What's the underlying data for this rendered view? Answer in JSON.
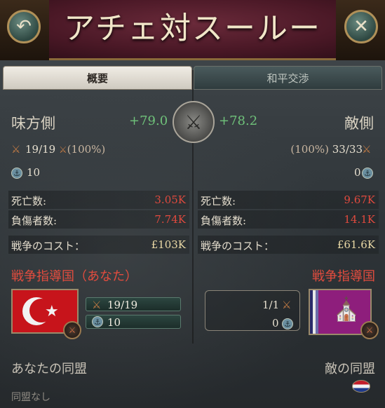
{
  "header": {
    "title": "アチェ対スールー",
    "back_icon": "back-arrow-icon",
    "close_icon": "close-icon"
  },
  "tabs": [
    {
      "label": "概要",
      "active": true
    },
    {
      "label": "和平交渉",
      "active": false
    }
  ],
  "center_icon": "crossed-swords-icon",
  "ally": {
    "title": "味方側",
    "score": "+79.0",
    "armies": "19/19",
    "armies_pct": "(​100%)",
    "ships": "10",
    "deaths_label": "死亡数:",
    "deaths": "3.05K",
    "wounded_label": "負傷者数:",
    "wounded": "7.74K",
    "cost_label": "戦争のコスト：",
    "cost": "£103K",
    "leader_label": "戦争指導国（あなた）",
    "leader_armies": "19/19",
    "leader_ships": "10",
    "alliance_label": "あなたの同盟",
    "alliance_none": "同盟なし"
  },
  "enemy": {
    "title": "敵側",
    "score": "+78.2",
    "armies": "33/33",
    "armies_pct": "(100%)",
    "ships": "0",
    "deaths_label": "死亡数:",
    "deaths": "9.67K",
    "wounded_label": "負傷者数:",
    "wounded": "14.1K",
    "cost_label": "戦争のコスト：",
    "cost": "£61.6K",
    "leader_label": "戦争指導国",
    "leader_armies": "1/1",
    "leader_ships": "0",
    "alliance_label": "敵の同盟"
  },
  "colors": {
    "score_green": "#6fc27a",
    "loss_red": "#e04a3e",
    "leader_red": "#e24c3e",
    "header_bg": "#4a1826"
  }
}
